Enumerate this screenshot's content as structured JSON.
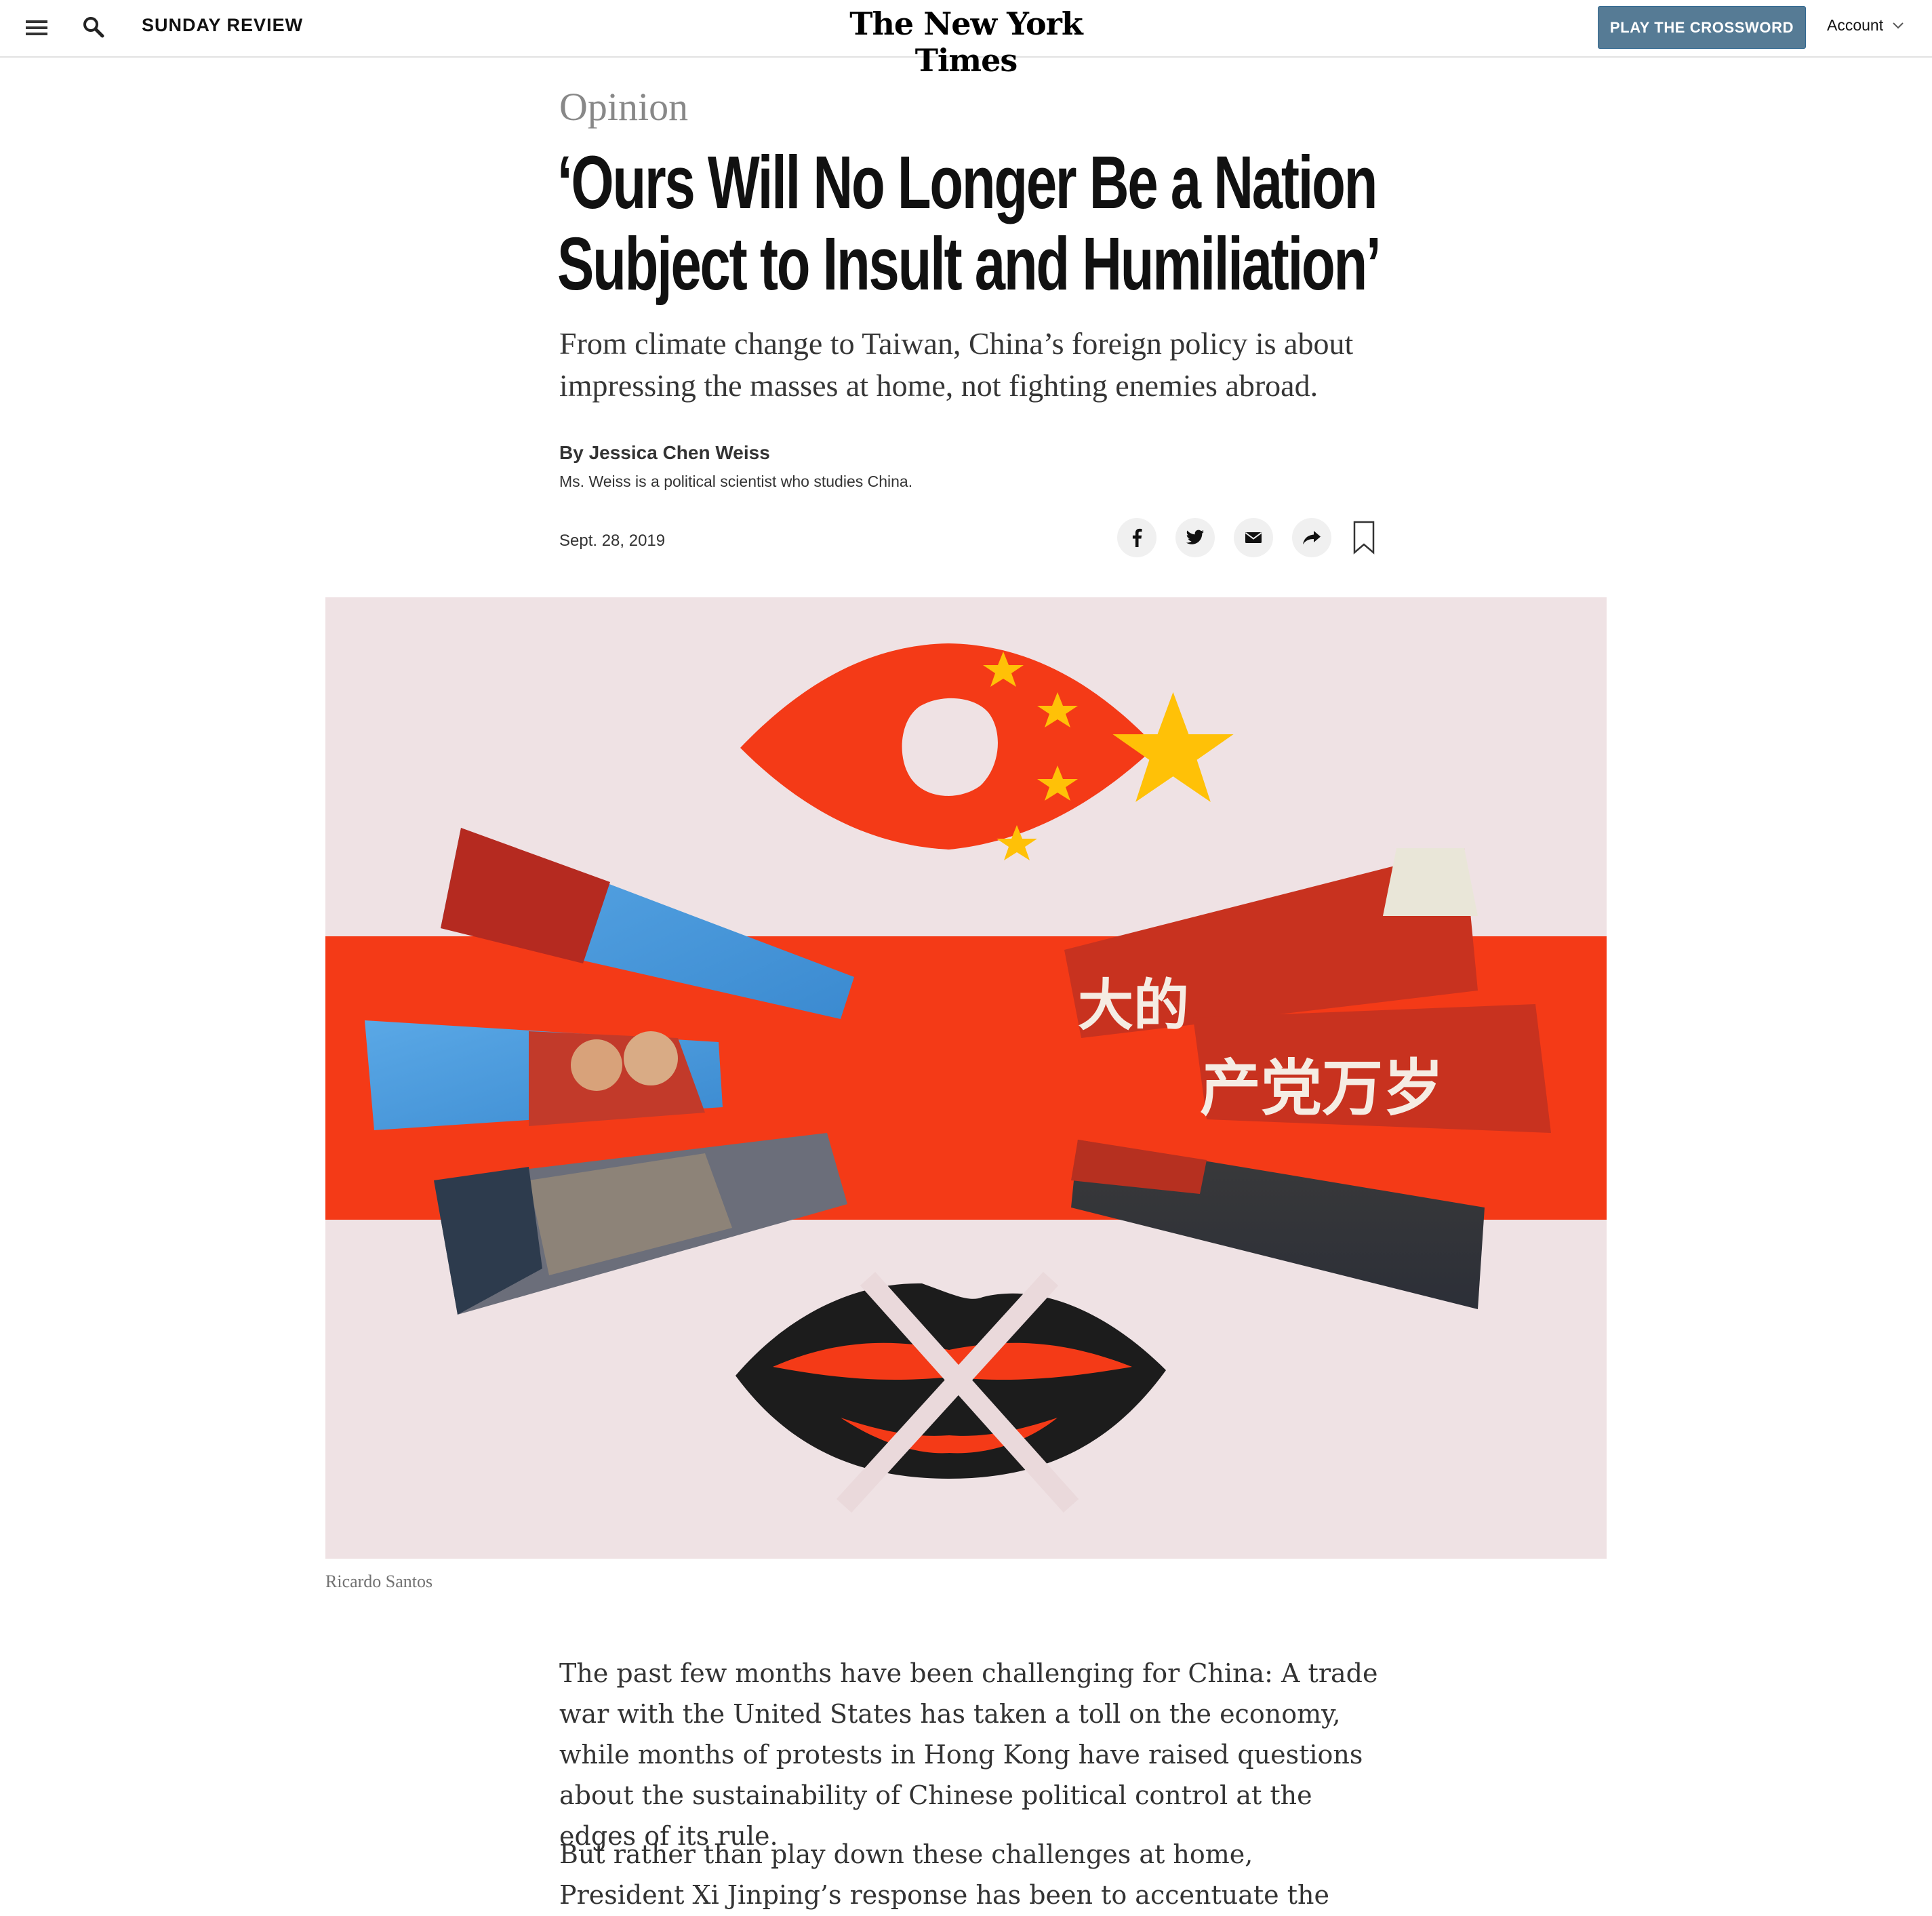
{
  "topbar": {
    "section_label": "SUNDAY REVIEW",
    "masthead": "The New York Times",
    "crossword_label": "PLAY THE CROSSWORD",
    "account_label": "Account"
  },
  "article": {
    "kicker": "Opinion",
    "headline_line1": "‘Ours Will No Longer Be a Nation",
    "headline_line2": "Subject to Insult and Humiliation’",
    "dek": "From climate change to Taiwan, China’s foreign policy is about impressing the masses at home, not fighting enemies abroad.",
    "byline_prefix": "By",
    "byline_author": "Jessica Chen Weiss",
    "bio": "Ms. Weiss is a political scientist who studies China.",
    "date": "Sept. 28, 2019"
  },
  "share": {
    "icons": [
      "facebook-icon",
      "twitter-icon",
      "email-icon",
      "share-icon",
      "bookmark-icon"
    ]
  },
  "image": {
    "credit": "Ricardo Santos",
    "banner_text_top": "大的",
    "banner_text_main": "产党万岁",
    "colors": {
      "background": "#efe2e4",
      "red": "#f43a17",
      "star_yellow": "#ffc107",
      "ink": "#1c1c1c"
    }
  },
  "body": {
    "paragraphs": [
      "The past few months have been challenging for China: A trade war with the United States has taken a toll on the economy, while months of protests in Hong Kong have raised questions about the sustainability of Chinese political control at the edges of its rule.",
      "But rather than play down these challenges at home, President Xi Jinping’s response has been to accentuate the peril of foreign"
    ]
  },
  "colors": {
    "crossword_button": "#567b95",
    "kicker": "#888888"
  }
}
